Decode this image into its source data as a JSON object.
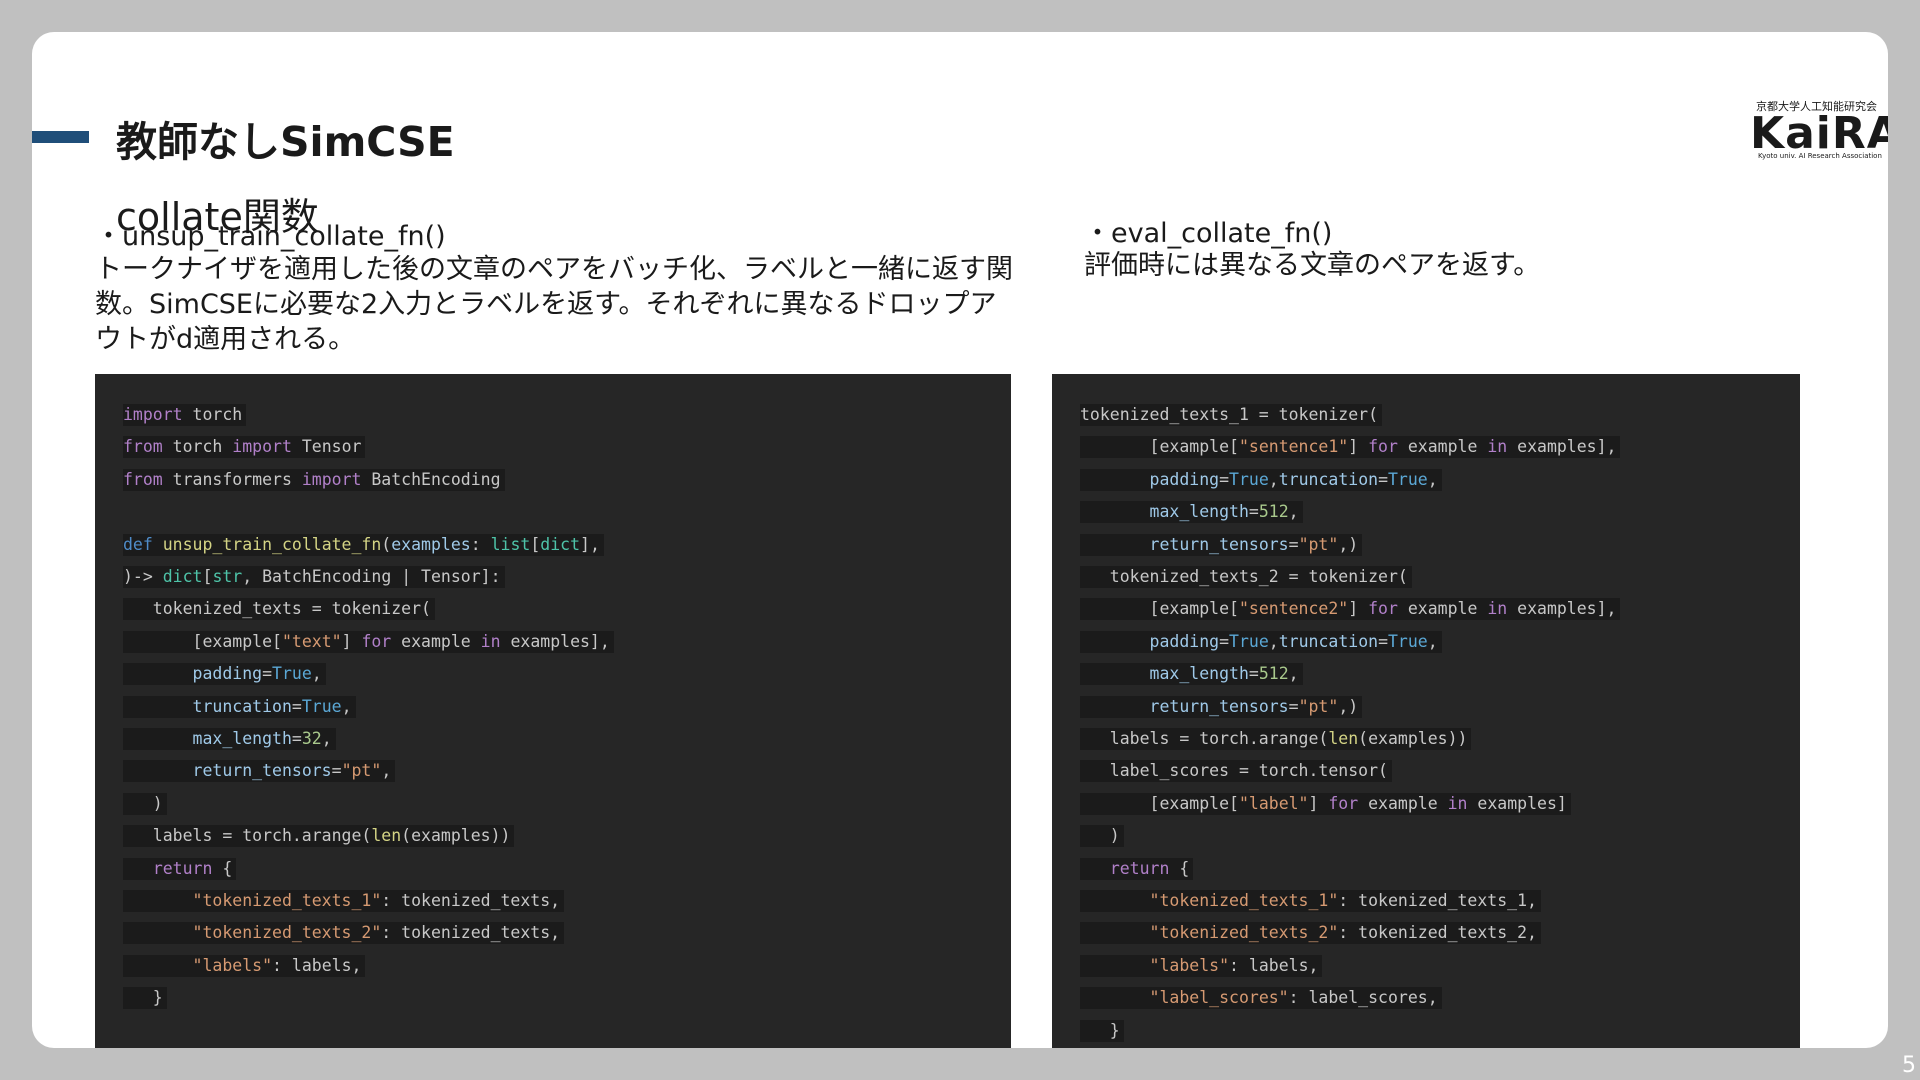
{
  "slide": {
    "title": "教師なしSimCSE",
    "subtitle": "collate関数",
    "page_number": "5"
  },
  "logo": {
    "top_text": "京都大学人工知能研究会",
    "mark": "KaiRA",
    "bottom_text": "Kyoto univ. AI Research Association"
  },
  "left": {
    "fn_label": "・unsup_train_collate_fn()",
    "description": "トークナイザを適用した後の文章のペアをバッチ化、ラベルと一緒に返す関数。SimCSEに必要な2入力とラベルを返す。それぞれに異なるドロップアウトがd適用される。",
    "code": [
      "import torch",
      "from torch import Tensor",
      "from transformers import BatchEncoding",
      "",
      "def unsup_train_collate_fn(examples: list[dict],",
      ")-> dict[str, BatchEncoding | Tensor]:",
      "   tokenized_texts = tokenizer(",
      "       [example[\"text\"] for example in examples],",
      "       padding=True,",
      "       truncation=True,",
      "       max_length=32,",
      "       return_tensors=\"pt\",",
      "   )",
      "   labels = torch.arange(len(examples))",
      "   return {",
      "       \"tokenized_texts_1\": tokenized_texts,",
      "       \"tokenized_texts_2\": tokenized_texts,",
      "       \"labels\": labels,",
      "   }"
    ]
  },
  "right": {
    "fn_label": "・eval_collate_fn()",
    "description": "評価時には異なる文章のペアを返す。",
    "code": [
      "tokenized_texts_1 = tokenizer(",
      "       [example[\"sentence1\"] for example in examples],",
      "       padding=True,truncation=True,",
      "       max_length=512,",
      "       return_tensors=\"pt\",)",
      "   tokenized_texts_2 = tokenizer(",
      "       [example[\"sentence2\"] for example in examples],",
      "       padding=True,truncation=True,",
      "       max_length=512,",
      "       return_tensors=\"pt\",)",
      "   labels = torch.arange(len(examples))",
      "   label_scores = torch.tensor(",
      "       [example[\"label\"] for example in examples]",
      "   )",
      "   return {",
      "       \"tokenized_texts_1\": tokenized_texts_1,",
      "       \"tokenized_texts_2\": tokenized_texts_2,",
      "       \"labels\": labels,",
      "       \"label_scores\": label_scores,",
      "   }"
    ]
  },
  "colors": {
    "page_background": "#c0c0c0",
    "slide_background": "#ffffff",
    "accent": "#1f4e79",
    "code_background": "#262626",
    "keyword": "#b180c9",
    "string": "#d69a72",
    "constant": "#5ba8d6"
  }
}
